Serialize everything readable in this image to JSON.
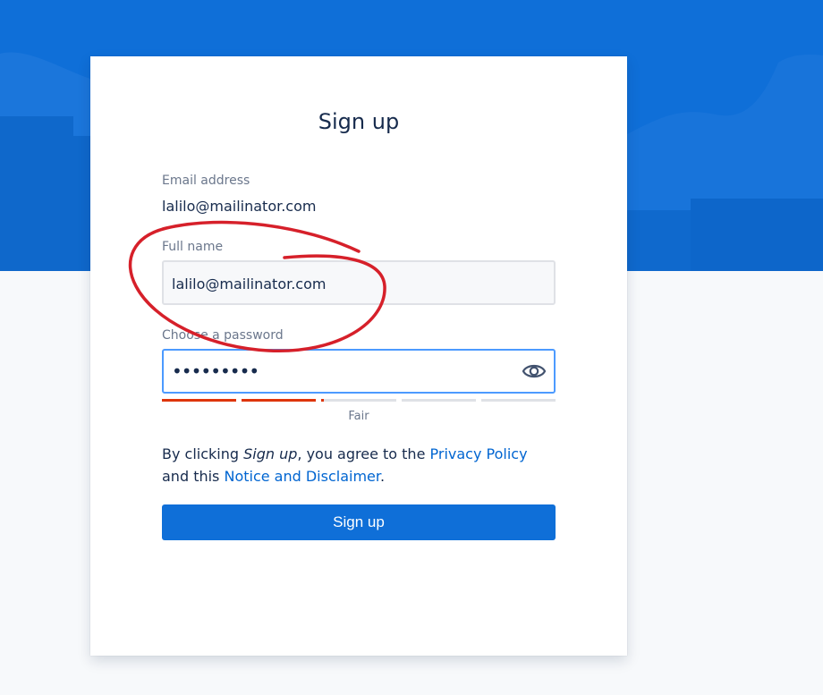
{
  "page": {
    "title": "Sign up"
  },
  "form": {
    "email_label": "Email address",
    "email_value": "lalilo@mailinator.com",
    "fullname_label": "Full name",
    "fullname_value": "lalilo@mailinator.com",
    "password_label": "Choose a password",
    "password_masked": "•••••••••",
    "password_strength": {
      "label": "Fair",
      "filled_segments": 2,
      "total_segments": 5
    },
    "terms": {
      "prefix": "By clicking ",
      "action": "Sign up",
      "middle": ", you agree to the ",
      "privacy_link": "Privacy Policy",
      "joiner": " and this ",
      "notice_link": "Notice and Disclaimer",
      "suffix": "."
    },
    "submit_label": "Sign up"
  },
  "icons": {
    "show_password": "eye-icon"
  },
  "colors": {
    "brand_blue": "#0f6fd8",
    "link_blue": "#0065d1",
    "strength_fill": "#de350b",
    "annotation_red": "#d6202a"
  }
}
